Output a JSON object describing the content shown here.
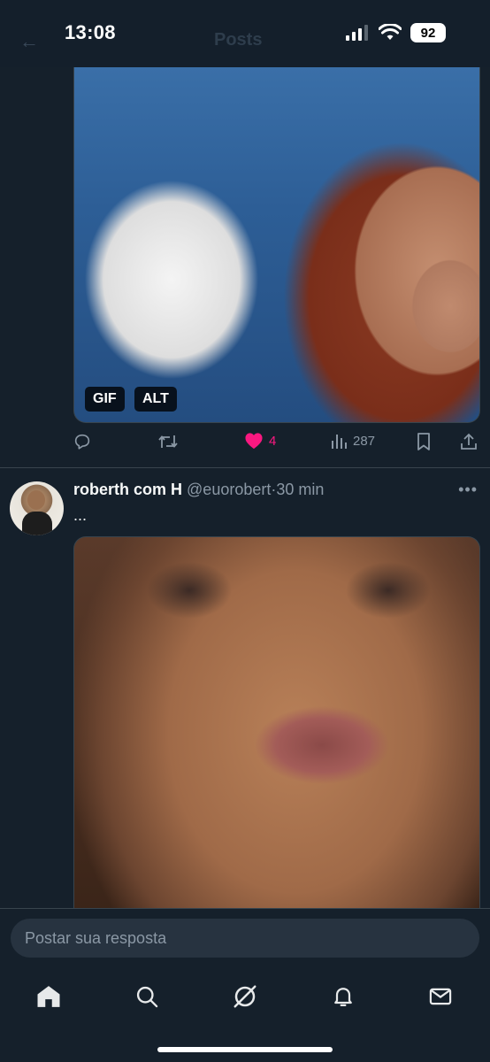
{
  "status_bar": {
    "time": "13:08",
    "battery": "92"
  },
  "header": {
    "back_label": "←",
    "title": "Posts"
  },
  "post1": {
    "media_badges": {
      "gif": "GIF",
      "alt": "ALT"
    },
    "actions": {
      "likes": "4",
      "views": "287"
    }
  },
  "post2": {
    "display_name": "roberth com H",
    "handle": "@euorobert",
    "separator": "·",
    "time": "30 min",
    "more": "•••",
    "text": "..."
  },
  "reply": {
    "placeholder": "Postar sua resposta"
  },
  "nav": {
    "items": [
      "home-icon",
      "search-icon",
      "grok-icon",
      "notifications-icon",
      "messages-icon"
    ]
  },
  "colors": {
    "background": "#15202b",
    "like": "#f91880",
    "muted": "#8b98a5",
    "border": "#38444d"
  }
}
